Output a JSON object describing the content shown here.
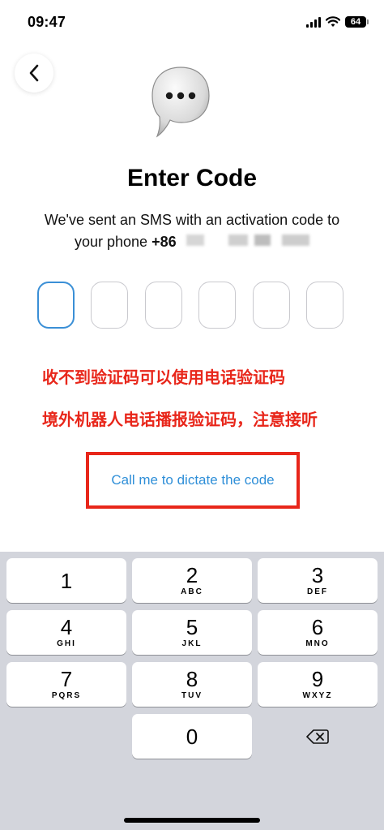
{
  "status_bar": {
    "time": "09:47",
    "battery": "64"
  },
  "title": "Enter Code",
  "subtitle_line1": "We've sent an SMS with an activation code to",
  "subtitle_line2_prefix": "your phone ",
  "phone_prefix": "+86",
  "code_boxes": [
    "",
    "",
    "",
    "",
    "",
    ""
  ],
  "annotations": {
    "line1": "收不到验证码可以使用电话验证码",
    "line2": "境外机器人电话播报验证码，注意接听"
  },
  "call_me_label": "Call me to dictate the code",
  "keypad": {
    "k1": {
      "digit": "1",
      "letters": ""
    },
    "k2": {
      "digit": "2",
      "letters": "ABC"
    },
    "k3": {
      "digit": "3",
      "letters": "DEF"
    },
    "k4": {
      "digit": "4",
      "letters": "GHI"
    },
    "k5": {
      "digit": "5",
      "letters": "JKL"
    },
    "k6": {
      "digit": "6",
      "letters": "MNO"
    },
    "k7": {
      "digit": "7",
      "letters": "PQRS"
    },
    "k8": {
      "digit": "8",
      "letters": "TUV"
    },
    "k9": {
      "digit": "9",
      "letters": "WXYZ"
    },
    "k0": {
      "digit": "0",
      "letters": ""
    }
  },
  "colors": {
    "accent": "#2f8fd8",
    "annotation": "#e8261a",
    "keypad_bg": "#d3d5dc"
  },
  "icons": {
    "back": "chevron-left-icon",
    "bubble": "speech-bubble-icon",
    "delete": "delete-backspace-icon",
    "signal": "cellular-signal-icon",
    "wifi": "wifi-icon",
    "battery": "battery-icon"
  }
}
